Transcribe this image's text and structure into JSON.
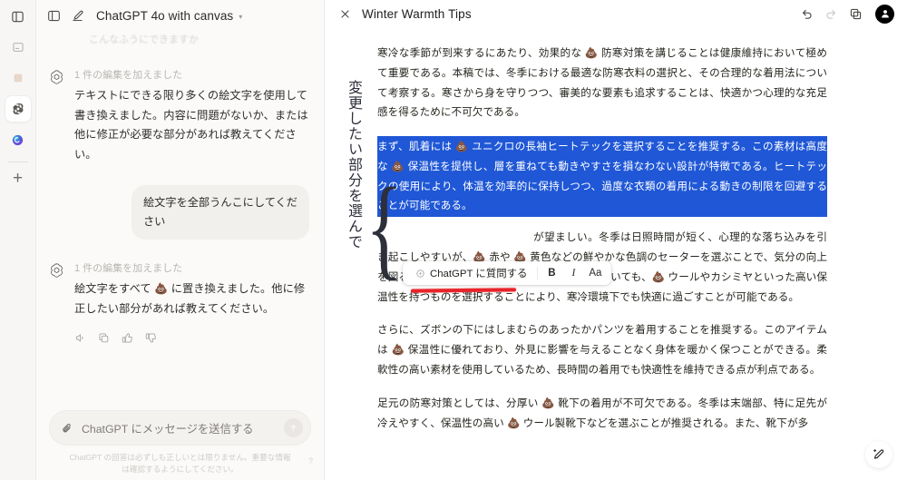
{
  "rail": {
    "items": [
      {
        "name": "panel-icon",
        "label": "Panel"
      },
      {
        "name": "note-icon",
        "label": "Notes"
      },
      {
        "name": "widget-icon",
        "label": "Widget"
      },
      {
        "name": "chatgpt-icon",
        "label": "ChatGPT"
      },
      {
        "name": "copilot-icon",
        "label": "Copilot"
      }
    ],
    "add_label": "+"
  },
  "chat": {
    "toolbar": {
      "sidebar_toggle_label": "Toggle sidebar",
      "new_chat_label": "New chat",
      "model_name": "ChatGPT 4o with canvas",
      "chevron": "▾"
    },
    "ghost_line": "こんなふうにできますか",
    "messages": [
      {
        "role": "assistant",
        "edit_note": "1 件の編集を加えました",
        "text": "テキストにできる限り多くの絵文字を使用して書き換えました。内容に問題がないか、または他に修正が必要な部分があれば教えてください。"
      },
      {
        "role": "user",
        "text": "絵文字を全部うんこにしてください"
      },
      {
        "role": "assistant",
        "edit_note": "1 件の編集を加えました",
        "text_before": "絵文字をすべて ",
        "emoji": "💩",
        "text_after": " に置き換えました。他に修正したい部分があれば教えてください。"
      }
    ],
    "message_actions": [
      {
        "name": "read-aloud-icon",
        "label": "読み上げる"
      },
      {
        "name": "copy-icon",
        "label": "コピーする"
      },
      {
        "name": "thumbs-up-icon",
        "label": "良い回答"
      },
      {
        "name": "thumbs-down-icon",
        "label": "悪い回答"
      }
    ],
    "composer": {
      "attach_label": "ファイルを添付",
      "placeholder": "ChatGPT にメッセージを送信する",
      "send_label": "送信"
    },
    "disclaimer": "ChatGPT の回答は必ずしも正しいとは限りません。重要な情報は確認するようにしてください。",
    "disclaimer_help": "?"
  },
  "canvas": {
    "close_label": "閉じる",
    "title": "Winter Warmth Tips",
    "actions": [
      {
        "name": "undo-icon",
        "label": "元に戻す",
        "disabled": false
      },
      {
        "name": "redo-icon",
        "label": "やり直す",
        "disabled": true
      },
      {
        "name": "copy-icon",
        "label": "コピー",
        "disabled": false
      }
    ],
    "avatar_label": "アカウント",
    "annotation": "変更したい部分を選んで",
    "brace": "{",
    "magic_pencil_label": "編集を提案",
    "selection_toolbar": {
      "ask_label": "ChatGPT に質問する",
      "sparkle": "✦",
      "bold_label": "B",
      "italic_label": "I",
      "font_label": "Aa"
    },
    "paragraphs": [
      {
        "selected": false,
        "emoji": "💩",
        "text": "寒冷な季節が到来するにあたり、効果的な 💩 防寒対策を講じることは健康維持において極めて重要である。本稿では、冬季における最適な防寒衣料の選択と、その合理的な着用法について考察する。寒さから身を守りつつ、審美的な要素も追求することは、快適かつ心理的な充足感を得るために不可欠である。"
      },
      {
        "selected": true,
        "text": "まず、肌着には 💩 ユニクロの長袖ヒートテックを選択することを推奨する。この素材は高度な 💩 保温性を提供し、層を重ねても動きやすさを損なわない設計が特徴である。ヒートテックの使用により、体温を効率的に保持しつつ、過度な衣類の着用による動きの制限を回避することが可能である。"
      },
      {
        "selected": false,
        "text": "が望ましい。冬季は日照時間が短く、心理的な落ち込みを引き起こしやすいが、💩 赤や 💩 黄色などの鮮やかな色調のセーターを選ぶことで、気分の向上を図ることができる。また、セーターの素材についても、💩 ウールやカシミヤといった高い保温性を持つものを選択することにより、寒冷環境下でも快適に過ごすことが可能である。"
      },
      {
        "selected": false,
        "text": "さらに、ズボンの下にはしまむらのあったかパンツを着用することを推奨する。このアイテムは 💩 保温性に優れており、外見に影響を与えることなく身体を暖かく保つことができる。柔軟性の高い素材を使用しているため、長時間の着用でも快適性を維持できる点が利点である。"
      },
      {
        "selected": false,
        "text": "足元の防寒対策としては、分厚い 💩 靴下の着用が不可欠である。冬季は末端部、特に足先が冷えやすく、保温性の高い 💩 ウール製靴下などを選ぶことが推奨される。また、靴下が多"
      }
    ]
  },
  "colors": {
    "selection_blue": "#1f57d6",
    "annotation_red": "#e8242a",
    "rail_bg": "#f7f6f4",
    "chat_bg": "#fbfaf9",
    "canvas_bg": "#ffffff"
  }
}
